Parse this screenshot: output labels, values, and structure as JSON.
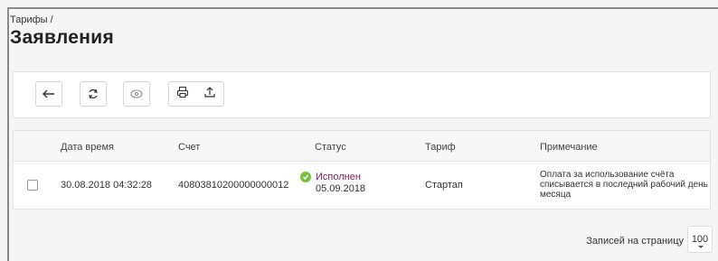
{
  "breadcrumb": "Тарифы /",
  "page_title": "Заявления",
  "toolbar": {
    "buttons": [
      "back-arrow-icon",
      "refresh-icon",
      "eye-icon"
    ],
    "group": [
      "print-icon",
      "upload-icon"
    ]
  },
  "table": {
    "headers": [
      "Дата время",
      "Счет",
      "Статус",
      "Тариф",
      "Примечание"
    ],
    "rows": [
      {
        "datetime": "30.08.2018 04:32:28",
        "account": "40803810200000000012",
        "status": "Исполнен",
        "status_date": "05.09.2018",
        "tariff": "Стартап",
        "note": "Оплата за использование счёта списывается в последний рабочий день месяца"
      }
    ]
  },
  "pager": {
    "label": "Записей на страницу",
    "value": "100"
  },
  "colors": {
    "status_text": "#8b1c5f",
    "status_ok": "#7ac142"
  }
}
